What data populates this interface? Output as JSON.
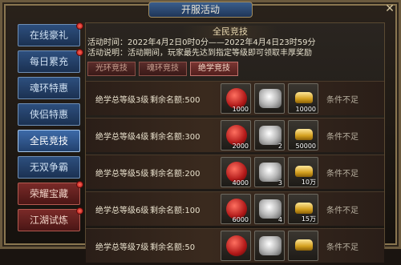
{
  "window": {
    "title": "开服活动",
    "close_icon": "close-icon",
    "help_label": "?"
  },
  "sidebar": {
    "items": [
      {
        "label": "在线豪礼",
        "style": "blue",
        "dot": true
      },
      {
        "label": "每日累充",
        "style": "blue",
        "dot": true
      },
      {
        "label": "魂环特惠",
        "style": "blue",
        "dot": false
      },
      {
        "label": "侠侣特惠",
        "style": "blue",
        "dot": false
      },
      {
        "label": "全民竞技",
        "style": "active",
        "dot": false
      },
      {
        "label": "无双争霸",
        "style": "blue",
        "dot": false
      },
      {
        "label": "荣耀宝藏",
        "style": "red",
        "dot": true
      },
      {
        "label": "江湖试炼",
        "style": "red",
        "dot": true
      }
    ]
  },
  "panel": {
    "title": "全民竞技",
    "time_line": "活动时间：2022年4月2日0时0分——2022年4月4日23时59分",
    "desc_line": "活动说明：活动期间，玩家最先达到指定等级即可领取丰厚奖励",
    "tabs": [
      {
        "label": "光环竞技",
        "active": false
      },
      {
        "label": "魂环竞技",
        "active": false
      },
      {
        "label": "绝学竞技",
        "active": true
      }
    ],
    "rows": [
      {
        "label": "绝学总等级3级",
        "remain": "剩余名额:500",
        "red_qty": "1000",
        "gray_qty": "",
        "gold_qty": "10000",
        "status": "条件不足"
      },
      {
        "label": "绝学总等级4级",
        "remain": "剩余名额:300",
        "red_qty": "2000",
        "gray_qty": "2",
        "gold_qty": "50000",
        "status": "条件不足"
      },
      {
        "label": "绝学总等级5级",
        "remain": "剩余名额:200",
        "red_qty": "4000",
        "gray_qty": "3",
        "gold_qty": "10万",
        "status": "条件不足"
      },
      {
        "label": "绝学总等级6级",
        "remain": "剩余名额:100",
        "red_qty": "6000",
        "gray_qty": "4",
        "gold_qty": "15万",
        "status": "条件不足"
      },
      {
        "label": "绝学总等级7级",
        "remain": "剩余名额:50",
        "red_qty": "",
        "gray_qty": "",
        "gold_qty": "",
        "status": "条件不足"
      }
    ]
  }
}
